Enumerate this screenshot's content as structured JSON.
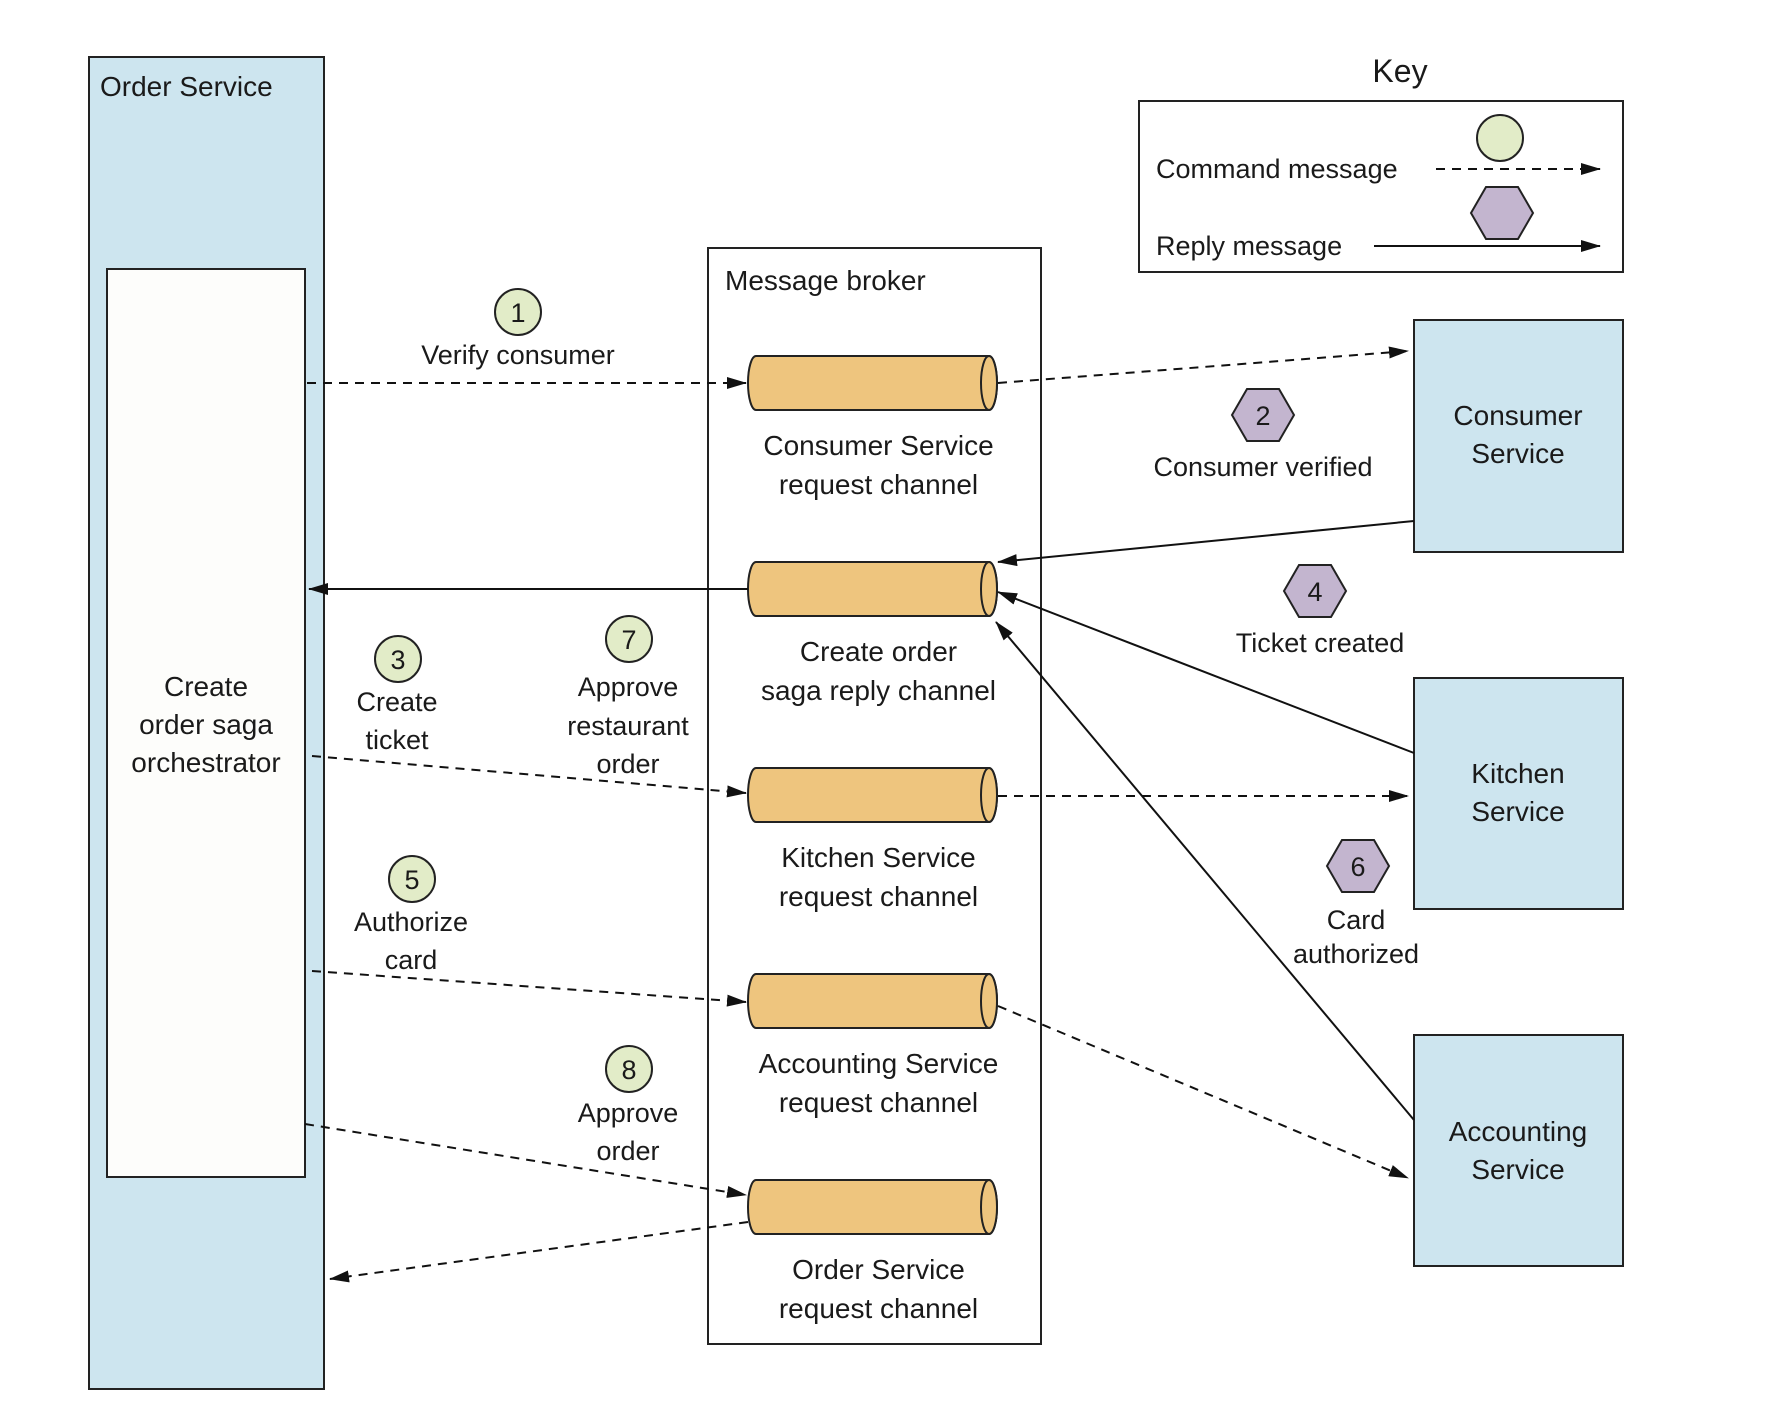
{
  "order_service": {
    "title": "Order Service",
    "orchestrator": [
      "Create",
      "order saga",
      "orchestrator"
    ]
  },
  "broker": {
    "title": "Message broker",
    "channels": [
      {
        "id": "consumer-request",
        "label": [
          "Consumer Service",
          "request channel"
        ]
      },
      {
        "id": "saga-reply",
        "label": [
          "Create order",
          "saga reply channel"
        ]
      },
      {
        "id": "kitchen-request",
        "label": [
          "Kitchen Service",
          "request channel"
        ]
      },
      {
        "id": "accounting-request",
        "label": [
          "Accounting Service",
          "request channel"
        ]
      },
      {
        "id": "order-request",
        "label": [
          "Order Service",
          "request channel"
        ]
      }
    ]
  },
  "services": [
    {
      "id": "consumer",
      "label": [
        "Consumer",
        "Service"
      ]
    },
    {
      "id": "kitchen",
      "label": [
        "Kitchen",
        "Service"
      ]
    },
    {
      "id": "accounting",
      "label": [
        "Accounting",
        "Service"
      ]
    }
  ],
  "steps": [
    {
      "n": "1",
      "kind": "command",
      "label": [
        "Verify consumer"
      ]
    },
    {
      "n": "2",
      "kind": "reply",
      "label": [
        "Consumer verified"
      ]
    },
    {
      "n": "3",
      "kind": "command",
      "label": [
        "Create",
        "ticket"
      ]
    },
    {
      "n": "4",
      "kind": "reply",
      "label": [
        "Ticket created"
      ]
    },
    {
      "n": "5",
      "kind": "command",
      "label": [
        "Authorize",
        "card"
      ]
    },
    {
      "n": "6",
      "kind": "reply",
      "label": [
        "Card",
        "authorized"
      ]
    },
    {
      "n": "7",
      "kind": "command",
      "label": [
        "Approve",
        "restaurant",
        "order"
      ]
    },
    {
      "n": "8",
      "kind": "command",
      "label": [
        "Approve",
        "order"
      ]
    }
  ],
  "key": {
    "title": "Key",
    "command_label": "Command message",
    "reply_label": "Reply message"
  },
  "colors": {
    "service_fill": "#cde5ef",
    "channel_fill": "#eec57e",
    "command_fill": "#e2ecc8",
    "reply_fill": "#c3b5cf"
  }
}
